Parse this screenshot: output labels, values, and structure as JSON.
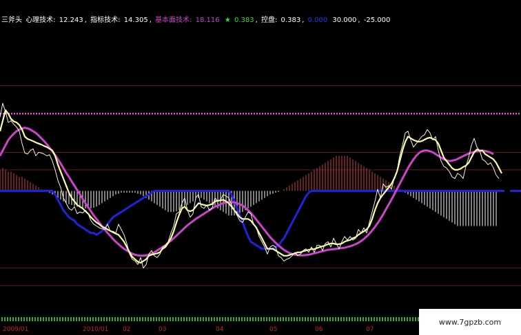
{
  "header": {
    "indicator_name": "三斧头",
    "items": [
      {
        "label": "心理技术:",
        "value": "12.243",
        "color": "#ffffff"
      },
      {
        "label": "指标技术:",
        "value": "14.305",
        "color": "#ffffff"
      },
      {
        "label": "基本面技术:",
        "value": "18.116",
        "color": "#cc44cc"
      },
      {
        "label": "★",
        "value": "0.383",
        "color": "#33dd33"
      },
      {
        "label": "控盘:",
        "value": "0.383",
        "color": "#ffffff"
      },
      {
        "label": "",
        "value": "0.000",
        "color": "#3333ee"
      },
      {
        "label": "",
        "value": "30.000",
        "color": "#ffffff"
      },
      {
        "label": "",
        "value": "-25.000",
        "color": "#ffffff"
      }
    ]
  },
  "x_labels": [
    "2009/01",
    "2010/01",
    "02",
    "03",
    "04",
    "05",
    "06",
    "07"
  ],
  "watermark": "www.7gpzb.com",
  "colors": {
    "background": "#000000",
    "white_line": "#f4f4dc",
    "yellow_line": "#ffffaa",
    "magenta_line": "#cc44cc",
    "blue_line": "#2222dd",
    "bars_negative": "#ffffff",
    "bars_positive": "#cc4444",
    "red_hlines": "#6a1a1a",
    "dotted_line": "#dd55dd"
  },
  "chart_data": {
    "type": "line",
    "x": [
      0,
      4,
      8,
      12,
      16,
      20,
      24,
      28,
      32,
      36,
      40,
      44,
      48,
      52,
      56,
      60,
      64,
      68,
      72,
      76,
      80,
      84,
      88,
      92,
      96,
      100,
      104,
      108,
      112,
      116,
      120,
      124,
      128,
      132,
      136,
      140,
      144,
      148,
      152,
      156,
      160,
      164,
      168,
      172,
      176,
      180,
      184,
      188,
      192,
      196,
      200,
      204,
      208,
      212,
      216,
      220,
      224,
      228,
      232,
      236,
      240,
      244,
      248,
      252,
      256,
      260,
      264,
      268,
      272,
      276,
      280,
      284,
      288,
      292,
      296,
      300,
      304,
      308,
      312,
      316,
      320,
      324,
      328,
      332,
      336,
      340,
      344,
      348,
      352,
      356,
      360,
      364,
      368,
      372,
      376,
      380,
      384,
      388,
      392,
      396,
      400,
      404,
      408,
      412,
      416,
      420,
      424,
      428,
      432,
      436,
      440,
      444,
      448,
      452,
      456,
      460,
      464,
      468,
      472,
      476,
      480,
      484,
      488,
      492,
      496,
      500,
      504,
      508,
      512,
      516,
      520,
      524,
      528,
      532,
      536,
      540,
      544,
      548,
      552,
      556,
      560,
      564,
      568,
      572,
      576,
      580,
      584,
      588,
      592,
      596,
      600,
      604,
      608,
      612,
      616,
      620,
      624,
      628,
      632,
      636,
      640,
      644,
      648,
      652,
      656,
      660,
      664,
      668,
      672,
      676,
      680,
      684,
      688,
      692,
      696,
      700,
      704,
      708,
      712,
      716,
      720,
      724,
      728,
      732,
      736,
      740
    ],
    "series": [
      {
        "name": "心理技术",
        "values": [
          21.0,
          25.0,
          22.5,
          19.5,
          20.0,
          19.0,
          18.2,
          17.0,
          13.5,
          10.8,
          10.5,
          11.5,
          12.0,
          10.0,
          11.0,
          10.8,
          10.5,
          10.0,
          10.3,
          8.5,
          6.0,
          3.0,
          1.0,
          -2.0,
          -3.5,
          -5.0,
          -5.5,
          -4.5,
          -6.5,
          -6.0,
          -6.3,
          -5.5,
          -6.5,
          -8.5,
          -9.5,
          -10.0,
          -10.5,
          -10.8,
          -11.0,
          -9.5,
          -11.5,
          -11.5,
          -12.0,
          -9.5,
          -11.0,
          -12.5,
          -15.0,
          -18.0,
          -19.5,
          -20.0,
          -21.0,
          -19.0,
          -22.0,
          -21.0,
          -18.0,
          -17.0,
          -18.5,
          -19.0,
          -18.0,
          -16.0,
          -15.5,
          -14.5,
          -12.0,
          -10.0,
          -6.5,
          -6.0,
          -3.5,
          -2.0,
          -5.5,
          -7.5,
          -6.5,
          -2.0,
          -1.0,
          -4.5,
          -5.0,
          -4.0,
          -5.5,
          -4.8,
          -2.0,
          -3.0,
          -2.5,
          -1.0,
          -1.5,
          -2.0,
          -4.0,
          -5.5,
          -7.0,
          -8.5,
          -9.0,
          -7.5,
          -6.0,
          -6.5,
          -9.5,
          -10.5,
          -13.0,
          -14.5,
          -16.0,
          -18.0,
          -16.0,
          -15.5,
          -16.0,
          -18.5,
          -19.0,
          -20.0,
          -19.5,
          -19.2,
          -18.5,
          -17.5,
          -18.5,
          -18.0,
          -17.0,
          -16.5,
          -17.5,
          -16.0,
          -17.5,
          -15.5,
          -15.5,
          -17.0,
          -15.0,
          -14.5,
          -16.0,
          -13.5,
          -15.0,
          -16.5,
          -14.5,
          -13.0,
          -14.0,
          -13.0,
          -14.0,
          -13.5,
          -11.0,
          -12.0,
          -10.5,
          -12.0,
          -9.0,
          -6.0,
          -3.0,
          0.5,
          -2.0,
          2.0,
          1.0,
          1.5,
          0.5,
          3.5,
          5.5,
          10.0,
          13.0,
          16.5,
          17.0,
          14.5,
          12.5,
          13.5,
          14.5,
          15.5,
          16.0,
          17.5,
          16.5,
          14.5,
          15.5,
          11.5,
          8.5,
          7.0,
          6.5,
          5.5,
          4.0,
          3.5,
          5.0,
          4.5,
          3.5,
          7.0,
          9.5,
          13.0,
          15.0,
          12.5,
          11.5,
          9.0,
          8.5,
          7.5,
          8.0,
          6.5,
          4.5,
          3.5
        ]
      },
      {
        "name": "指标技术",
        "values": [
          17.0,
          20.0,
          23.0,
          22.0,
          20.5,
          19.8,
          19.5,
          18.8,
          17.5,
          15.5,
          14.8,
          14.5,
          14.2,
          13.8,
          13.5,
          13.2,
          12.8,
          12.5,
          12.0,
          11.5,
          10.0,
          7.5,
          5.5,
          3.5,
          1.5,
          -0.5,
          -2.0,
          -3.0,
          -4.0,
          -4.5,
          -5.0,
          -5.8,
          -6.5,
          -7.5,
          -8.3,
          -9.0,
          -9.5,
          -10.2,
          -10.5,
          -11.0,
          -11.4,
          -11.8,
          -12.2,
          -12.5,
          -13.5,
          -14.5,
          -16.0,
          -17.5,
          -18.8,
          -19.5,
          -20.2,
          -20.5,
          -20.0,
          -19.5,
          -18.5,
          -18.2,
          -18.0,
          -17.8,
          -17.5,
          -16.5,
          -16.0,
          -14.8,
          -13.5,
          -11.5,
          -9.0,
          -6.8,
          -5.0,
          -4.5,
          -5.5,
          -5.8,
          -5.5,
          -4.5,
          -3.5,
          -3.8,
          -4.0,
          -4.2,
          -4.0,
          -3.7,
          -3.0,
          -2.8,
          -2.7,
          -2.5,
          -3.0,
          -3.5,
          -4.5,
          -5.5,
          -6.5,
          -7.5,
          -8.0,
          -8.0,
          -8.0,
          -8.5,
          -9.5,
          -10.5,
          -12.0,
          -13.5,
          -15.0,
          -16.5,
          -16.5,
          -16.5,
          -17.0,
          -17.5,
          -18.0,
          -18.5,
          -18.5,
          -18.3,
          -18.0,
          -17.8,
          -17.5,
          -17.5,
          -17.2,
          -17.0,
          -16.8,
          -16.6,
          -16.6,
          -16.3,
          -16.0,
          -15.8,
          -15.5,
          -15.2,
          -15.0,
          -15.0,
          -15.2,
          -15.2,
          -15.0,
          -14.5,
          -14.2,
          -14.0,
          -13.5,
          -13.2,
          -12.5,
          -12.0,
          -11.5,
          -11.0,
          -10.0,
          -8.0,
          -5.5,
          -3.5,
          -2.0,
          -1.0,
          0.0,
          1.0,
          2.0,
          3.5,
          5.5,
          8.5,
          11.5,
          14.0,
          15.5,
          15.0,
          14.5,
          14.2,
          14.0,
          14.2,
          14.6,
          15.0,
          15.2,
          14.8,
          14.5,
          13.5,
          11.5,
          9.5,
          8.5,
          7.5,
          6.5,
          6.0,
          6.0,
          6.3,
          6.8,
          7.2,
          8.0,
          9.5,
          11.0,
          11.8,
          11.5,
          11.5,
          10.5,
          10.0,
          9.5,
          9.0,
          8.0,
          6.5,
          5.0
        ]
      },
      {
        "name": "基本面技术",
        "values": [
          10.0,
          11.5,
          13.0,
          14.5,
          15.5,
          16.3,
          17.0,
          17.5,
          17.8,
          18.0,
          17.8,
          17.5,
          17.0,
          16.5,
          15.8,
          15.0,
          14.2,
          13.3,
          12.3,
          11.3,
          10.2,
          9.0,
          7.8,
          6.5,
          5.2,
          4.0,
          2.7,
          1.5,
          0.2,
          -1.0,
          -2.3,
          -3.5,
          -4.7,
          -5.8,
          -7.0,
          -8.0,
          -9.0,
          -10.0,
          -11.0,
          -12.0,
          -12.8,
          -13.7,
          -14.5,
          -15.2,
          -15.9,
          -16.5,
          -17.0,
          -17.5,
          -17.9,
          -18.2,
          -18.4,
          -18.5,
          -18.5,
          -18.4,
          -18.2,
          -17.9,
          -17.5,
          -17.0,
          -16.5,
          -16.0,
          -15.5,
          -14.8,
          -14.2,
          -13.5,
          -12.8,
          -12.0,
          -11.3,
          -10.5,
          -9.8,
          -9.2,
          -8.6,
          -8.0,
          -7.5,
          -7.0,
          -6.5,
          -6.0,
          -5.5,
          -5.0,
          -4.5,
          -4.2,
          -3.8,
          -3.5,
          -3.3,
          -3.2,
          -3.2,
          -3.3,
          -3.5,
          -3.8,
          -4.2,
          -4.8,
          -5.5,
          -6.3,
          -7.2,
          -8.2,
          -9.2,
          -10.2,
          -11.2,
          -12.2,
          -13.2,
          -14.0,
          -14.8,
          -15.5,
          -16.2,
          -16.8,
          -17.3,
          -17.7,
          -18.0,
          -18.2,
          -18.3,
          -18.4,
          -18.4,
          -18.3,
          -18.2,
          -18.0,
          -17.8,
          -17.6,
          -17.4,
          -17.2,
          -17.0,
          -16.8,
          -16.7,
          -16.6,
          -16.5,
          -16.4,
          -16.3,
          -16.2,
          -16.0,
          -15.8,
          -15.5,
          -15.2,
          -14.8,
          -14.3,
          -13.7,
          -13.0,
          -12.2,
          -11.3,
          -10.3,
          -9.2,
          -8.0,
          -6.7,
          -5.3,
          -3.9,
          -2.5,
          -1.0,
          0.5,
          2.0,
          3.5,
          5.0,
          6.5,
          7.8,
          9.0,
          10.0,
          10.8,
          11.3,
          11.5,
          11.5,
          11.3,
          11.0,
          10.5,
          10.0,
          9.5,
          9.0,
          8.7,
          8.5,
          8.6,
          8.8,
          9.1,
          9.5,
          9.9,
          10.3,
          10.6,
          10.9,
          11.1,
          11.3,
          11.4,
          11.5,
          11.4,
          11.2,
          10.9,
          10.5
        ]
      },
      {
        "name": "控盘",
        "values": [
          0.0,
          0.0,
          0.0,
          0.0,
          0.0,
          0.0,
          0.0,
          0.0,
          0.0,
          0.0,
          0.0,
          0.0,
          0.0,
          0.0,
          0.0,
          0.0,
          0.0,
          0.0,
          0.0,
          0.0,
          -1.0,
          -2.5,
          -4.0,
          -5.5,
          -6.5,
          -7.5,
          -8.0,
          -8.5,
          -9.5,
          -10.0,
          -10.5,
          -11.0,
          -11.5,
          -12.0,
          -12.0,
          -12.5,
          -12.0,
          -11.5,
          -10.5,
          -9.5,
          -8.5,
          -7.5,
          -7.0,
          -6.5,
          -6.0,
          -5.5,
          -5.0,
          -4.5,
          -4.0,
          -3.5,
          -3.0,
          -2.5,
          -2.0,
          -1.5,
          -1.0,
          -0.5,
          0.0,
          0.0,
          0.0,
          0.0,
          0.0,
          0.0,
          0.0,
          0.0,
          0.0,
          0.0,
          0.0,
          0.0,
          0.0,
          0.0,
          0.0,
          0.0,
          0.0,
          0.0,
          0.0,
          0.0,
          0.0,
          0.0,
          0.0,
          0.0,
          0.0,
          0.0,
          0.0,
          0.0,
          -1.0,
          -3.0,
          -5.0,
          -7.0,
          -9.0,
          -11.0,
          -13.0,
          -14.5,
          -15.0,
          -15.5,
          -16.0,
          -16.5,
          -16.5,
          -16.5,
          -16.5,
          -16.5,
          -16.0,
          -15.5,
          -14.5,
          -13.5,
          -12.0,
          -10.5,
          -9.0,
          -7.5,
          -6.0,
          -4.5,
          -3.0,
          -1.5,
          -0.5,
          0.0,
          0.0,
          0.0,
          0.0,
          0.0,
          0.0,
          0.0,
          0.0,
          0.0,
          0.0,
          0.0,
          0.0,
          0.0,
          0.0,
          0.0,
          0.0,
          0.0,
          0.0,
          0.0,
          0.0,
          0.0,
          0.0,
          0.0,
          0.0,
          0.0,
          0.0,
          0.0,
          0.0,
          0.0,
          0.0,
          0.0,
          0.0,
          0.0,
          0.0,
          0.0,
          0.0,
          0.0,
          0.0,
          0.0,
          0.0,
          0.0,
          0.0,
          0.0,
          0.0,
          0.0,
          0.0,
          0.0,
          0.0,
          0.0,
          0.0,
          0.0,
          0.0,
          0.0,
          0.0,
          0.0,
          0.0,
          0.0,
          0.0,
          0.0,
          0.0,
          0.0,
          0.0,
          0.0,
          0.0,
          0.0,
          0.0,
          0.0,
          0.0,
          0.0,
          0.0,
          0.0
        ]
      },
      {
        "name": "柱状",
        "values": [
          6.0,
          6.5,
          6.0,
          5.5,
          5.5,
          5.0,
          4.5,
          4.0,
          4.0,
          3.5,
          3.0,
          2.5,
          2.0,
          1.5,
          1.0,
          0.5,
          0.0,
          -0.3,
          -0.6,
          -1.0,
          -1.5,
          -2.0,
          -2.5,
          -3.0,
          -3.5,
          -3.8,
          -4.0,
          -4.3,
          -4.5,
          -4.8,
          -5.0,
          -5.0,
          -5.0,
          -5.0,
          -4.8,
          -4.5,
          -4.0,
          -3.5,
          -3.0,
          -2.5,
          -2.0,
          -1.5,
          -1.0,
          -0.8,
          -0.5,
          -0.5,
          -0.5,
          -0.5,
          -0.5,
          -0.5,
          -0.8,
          -1.0,
          -1.5,
          -2.0,
          -2.5,
          -3.0,
          -3.5,
          -4.0,
          -4.5,
          -5.0,
          -5.5,
          -6.0,
          -6.0,
          -6.0,
          -5.8,
          -5.5,
          -5.0,
          -4.5,
          -4.0,
          -3.5,
          -3.0,
          -2.5,
          -2.0,
          -2.0,
          -2.5,
          -3.0,
          -3.5,
          -4.0,
          -4.5,
          -5.0,
          -5.5,
          -6.0,
          -6.5,
          -7.0,
          -7.0,
          -7.0,
          -6.8,
          -6.5,
          -6.0,
          -5.5,
          -5.0,
          -4.5,
          -4.0,
          -3.5,
          -3.0,
          -2.5,
          -2.0,
          -1.5,
          -1.0,
          -0.8,
          -0.5,
          -0.3,
          0.0,
          0.5,
          1.0,
          1.5,
          2.0,
          2.5,
          3.0,
          3.5,
          4.0,
          4.5,
          5.0,
          5.5,
          6.0,
          6.5,
          7.0,
          7.5,
          8.0,
          8.5,
          9.0,
          9.5,
          10.0,
          10.0,
          10.0,
          10.0,
          10.0,
          9.5,
          9.0,
          8.5,
          8.0,
          7.5,
          7.0,
          6.5,
          6.0,
          5.5,
          5.0,
          4.5,
          4.0,
          3.5,
          3.0,
          2.5,
          2.0,
          1.5,
          1.0,
          0.5,
          0.0,
          -0.5,
          -1.0,
          -1.5,
          -2.0,
          -2.5,
          -3.0,
          -3.5,
          -4.0,
          -4.5,
          -5.0,
          -5.5,
          -6.0,
          -6.5,
          -7.0,
          -7.5,
          -8.0,
          -8.5,
          -9.0,
          -9.5,
          -10.0,
          -10.0,
          -10.0,
          -10.0,
          -10.0,
          -10.0,
          -10.0,
          -10.0,
          -10.0,
          -10.0,
          -10.0,
          -10.0,
          -10.0,
          -10.0,
          -10.0
        ]
      }
    ],
    "reference_lines": [
      30,
      22,
      11,
      6,
      0,
      -22,
      -27
    ],
    "ylim": [
      -35,
      45
    ],
    "x_axis_labels": [
      "2009/01",
      "2010/01",
      "02",
      "03",
      "04",
      "05",
      "06",
      "07"
    ]
  }
}
